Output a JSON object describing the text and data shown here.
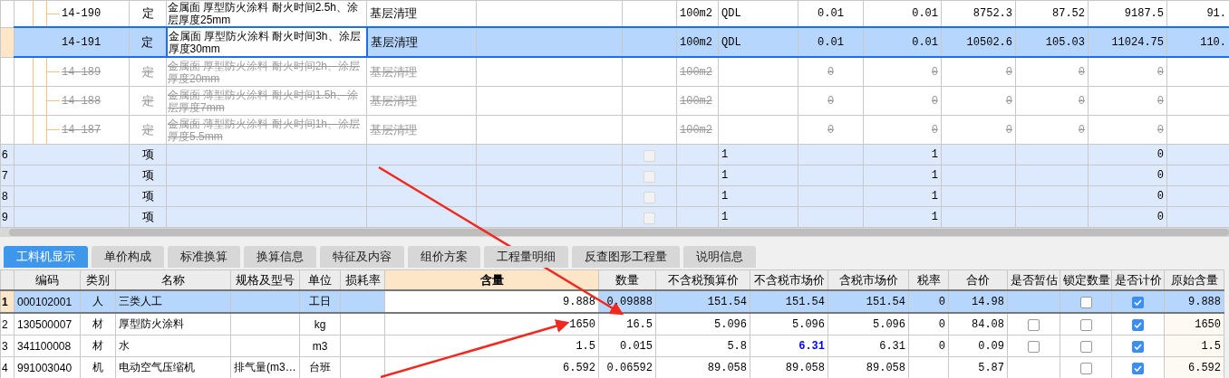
{
  "top_grid": {
    "rows": [
      {
        "kind": "quota",
        "code": "14-190",
        "type": "定",
        "name": "金属面 厚型防火涂料 耐火时间2.5h、涂层厚度25mm",
        "feature": "基层清理",
        "unit": "100m2",
        "column_8": "QDL",
        "column_9": "0.01",
        "column_10": "0.01",
        "column_11": "8752.3",
        "column_12": "87.52",
        "column_13": "9187.5",
        "column_14": "91.",
        "selected": false,
        "struck": false
      },
      {
        "kind": "quota",
        "code": "14-191",
        "type": "定",
        "name": "金属面 厚型防火涂料 耐火时间3h、涂层厚度30mm",
        "feature": "基层清理",
        "unit": "100m2",
        "column_8": "QDL",
        "column_9": "0.01",
        "column_10": "0.01",
        "column_11": "10502.6",
        "column_12": "105.03",
        "column_13": "11024.75",
        "column_14": "110.",
        "selected": true,
        "struck": false
      },
      {
        "kind": "quota",
        "code": "14-189",
        "type": "定",
        "name": "金属面 厚型防火涂料 耐火时间2h、涂层厚度20mm",
        "feature": "基层清理",
        "unit": "100m2",
        "column_8": "",
        "column_9": "0",
        "column_10": "0",
        "column_11": "0",
        "column_12": "0",
        "column_13": "0",
        "column_14": "",
        "selected": false,
        "struck": true
      },
      {
        "kind": "quota",
        "code": "14-188",
        "type": "定",
        "name": "金属面 薄型防火涂料 耐火时间1.5h、涂层厚度7mm",
        "feature": "基层清理",
        "unit": "100m2",
        "column_8": "",
        "column_9": "0",
        "column_10": "0",
        "column_11": "0",
        "column_12": "0",
        "column_13": "0",
        "column_14": "",
        "selected": false,
        "struck": true
      },
      {
        "kind": "quota",
        "code": "14-187",
        "type": "定",
        "name": "金属面 薄型防火涂料 耐火时间1h、涂层厚度5.5mm",
        "feature": "基层清理",
        "unit": "100m2",
        "column_8": "",
        "column_9": "0",
        "column_10": "0",
        "column_11": "0",
        "column_12": "0",
        "column_13": "0",
        "column_14": "",
        "selected": false,
        "struck": true
      },
      {
        "kind": "item",
        "row_number": "6",
        "type": "项",
        "checked": false,
        "column_8": "1",
        "column_10": "1",
        "column_13": "0"
      },
      {
        "kind": "item",
        "row_number": "7",
        "type": "项",
        "checked": false,
        "column_8": "1",
        "column_10": "1",
        "column_13": "0"
      },
      {
        "kind": "item",
        "row_number": "8",
        "type": "项",
        "checked": false,
        "column_8": "1",
        "column_10": "1",
        "column_13": "0"
      },
      {
        "kind": "item",
        "row_number": "9",
        "type": "项",
        "checked": false,
        "column_8": "1",
        "column_10": "1",
        "column_13": "0"
      }
    ]
  },
  "tabs": [
    {
      "label": "工料机显示",
      "selected": true
    },
    {
      "label": "单价构成",
      "selected": false
    },
    {
      "label": "标准换算",
      "selected": false
    },
    {
      "label": "换算信息",
      "selected": false
    },
    {
      "label": "特征及内容",
      "selected": false
    },
    {
      "label": "组价方案",
      "selected": false
    },
    {
      "label": "工程量明细",
      "selected": false
    },
    {
      "label": "反查图形工程量",
      "selected": false
    },
    {
      "label": "说明信息",
      "selected": false
    }
  ],
  "materials": {
    "columns": [
      "编码",
      "类别",
      "名称",
      "规格及型号",
      "单位",
      "损耗率",
      "含量",
      "数量",
      "不含税预算价",
      "不含税市场价",
      "含税市场价",
      "税率",
      "合价",
      "是否暂估",
      "锁定数量",
      "是否计价",
      "原始含量"
    ],
    "rows": [
      {
        "row_number": "1",
        "code": "000102001",
        "category": "人",
        "name": "三类人工",
        "spec": "",
        "unit": "工日",
        "content": "9.888",
        "quantity": "0.09888",
        "budget_price": "151.54",
        "market_price": "151.54",
        "tax_market_price": "151.54",
        "tax_rate": "0",
        "total": "14.98",
        "locked": false,
        "priced": true,
        "original": "9.888",
        "selected": true,
        "price_adjusted": false
      },
      {
        "row_number": "2",
        "code": "130500007",
        "category": "材",
        "name": "厚型防火涂料",
        "spec": "",
        "unit": "kg",
        "content": "1650",
        "quantity": "16.5",
        "budget_price": "5.096",
        "market_price": "5.096",
        "tax_market_price": "5.096",
        "tax_rate": "0",
        "total": "84.08",
        "estimate": false,
        "locked": false,
        "priced": true,
        "original": "1650",
        "selected": false,
        "price_adjusted": false
      },
      {
        "row_number": "3",
        "code": "341100008",
        "category": "材",
        "name": "水",
        "spec": "",
        "unit": "m3",
        "content": "1.5",
        "quantity": "0.015",
        "budget_price": "5.8",
        "market_price": "6.31",
        "tax_market_price": "6.31",
        "tax_rate": "0",
        "total": "0.09",
        "estimate": false,
        "locked": false,
        "priced": true,
        "original": "1.5",
        "selected": false,
        "price_adjusted": true
      },
      {
        "row_number": "4",
        "code": "991003040",
        "category": "机",
        "name": "电动空气压缩机",
        "spec": "排气量(m3…",
        "unit": "台班",
        "content": "6.592",
        "quantity": "0.06592",
        "budget_price": "89.058",
        "market_price": "89.058",
        "tax_market_price": "89.058",
        "tax_rate": "",
        "total": "5.87",
        "locked": false,
        "priced": true,
        "original": "6.592",
        "selected": false,
        "price_adjusted": false
      }
    ]
  }
}
